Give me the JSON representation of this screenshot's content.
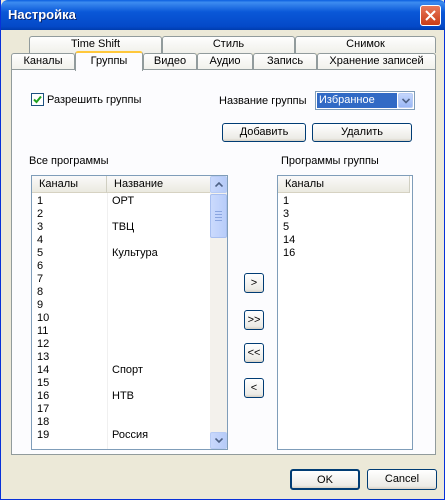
{
  "window": {
    "title": "Настройка"
  },
  "tabs_back": [
    "Time Shift",
    "Стиль",
    "Снимок"
  ],
  "tabs_front": [
    "Каналы",
    "Группы",
    "Видео",
    "Аудио",
    "Запись",
    "Хранение записей"
  ],
  "active_tab": "Группы",
  "groups": {
    "enable_label": "Разрешить группы",
    "enable_checked": true,
    "group_name_label": "Название группы",
    "group_name_value": "Избранное",
    "add_button": "Добавить",
    "delete_button": "Удалить"
  },
  "all_programs": {
    "title": "Все программы",
    "columns": [
      "Каналы",
      "Название"
    ],
    "rows": [
      [
        "1",
        "ОРТ"
      ],
      [
        "2",
        ""
      ],
      [
        "3",
        "ТВЦ"
      ],
      [
        "4",
        ""
      ],
      [
        "5",
        "Культура"
      ],
      [
        "6",
        ""
      ],
      [
        "7",
        ""
      ],
      [
        "8",
        ""
      ],
      [
        "9",
        ""
      ],
      [
        "10",
        ""
      ],
      [
        "11",
        ""
      ],
      [
        "12",
        ""
      ],
      [
        "13",
        ""
      ],
      [
        "14",
        "Спорт"
      ],
      [
        "15",
        ""
      ],
      [
        "16",
        "НТВ"
      ],
      [
        "17",
        ""
      ],
      [
        "18",
        ""
      ],
      [
        "19",
        "Россия"
      ]
    ]
  },
  "move_buttons": [
    ">",
    ">>",
    "<<",
    "<"
  ],
  "group_programs": {
    "title": "Программы группы",
    "columns": [
      "Каналы"
    ],
    "rows": [
      "1",
      "3",
      "5",
      "14",
      "16"
    ]
  },
  "footer": {
    "ok": "OK",
    "cancel": "Cancel"
  }
}
